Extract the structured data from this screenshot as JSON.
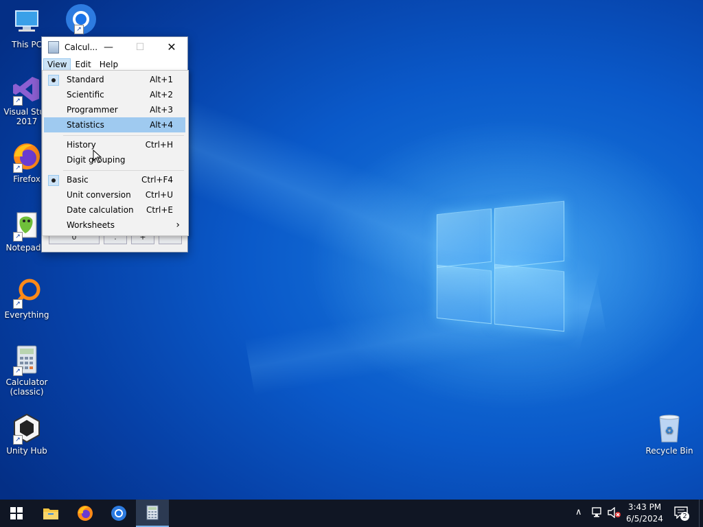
{
  "desktop": {
    "icons": [
      {
        "label": "This PC",
        "icon": "computer-icon"
      },
      {
        "label": "Visual Studio 2017",
        "icon": "visual-studio-icon"
      },
      {
        "label": "Firefox",
        "icon": "firefox-icon"
      },
      {
        "label": "Notepad++",
        "icon": "notepadpp-icon"
      },
      {
        "label": "Everything",
        "icon": "everything-search-icon"
      },
      {
        "label": "Calculator (classic)",
        "icon": "calculator-icon"
      },
      {
        "label": "Unity Hub",
        "icon": "unity-hub-icon"
      },
      {
        "label": "Recycle Bin",
        "icon": "recycle-bin-icon"
      }
    ],
    "icon_labels_visible": {
      "this_pc": "This PC",
      "visual_studio_line1": "Visual Stud",
      "visual_studio_line2": "2017",
      "firefox": "Firefox",
      "notepadpp": "Notepad+",
      "everything": "Everything",
      "calculator_line1": "Calculator",
      "calculator_line2": "(classic)",
      "unity": "Unity Hub",
      "recycle": "Recycle Bin"
    }
  },
  "calculator": {
    "title": "Calcul...",
    "minimize_glyph": "—",
    "maximize_glyph": "☐",
    "close_glyph": "✕",
    "menu": {
      "view": "View",
      "edit": "Edit",
      "help": "Help"
    },
    "partial_keys": [
      "0",
      ".",
      "+",
      ""
    ]
  },
  "view_menu": {
    "items": [
      {
        "label": "Standard",
        "shortcut": "Alt+1",
        "checked": true
      },
      {
        "label": "Scientific",
        "shortcut": "Alt+2",
        "checked": false
      },
      {
        "label": "Programmer",
        "shortcut": "Alt+3",
        "checked": false
      },
      {
        "label": "Statistics",
        "shortcut": "Alt+4",
        "checked": false,
        "highlighted": true
      },
      {
        "label": "History",
        "shortcut": "Ctrl+H",
        "checked": false
      },
      {
        "label": "Digit grouping",
        "shortcut": "",
        "checked": false
      },
      {
        "label": "Basic",
        "shortcut": "Ctrl+F4",
        "checked": true
      },
      {
        "label": "Unit conversion",
        "shortcut": "Ctrl+U",
        "checked": false
      },
      {
        "label": "Date calculation",
        "shortcut": "Ctrl+E",
        "checked": false
      },
      {
        "label": "Worksheets",
        "shortcut": "",
        "checked": false,
        "submenu": true
      }
    ],
    "submenu_glyph": "›"
  },
  "taskbar": {
    "items": [
      "start",
      "file-explorer",
      "firefox",
      "chrome",
      "calculator"
    ],
    "time": "3:43 PM",
    "date": "6/5/2024",
    "notification_count": "2",
    "tray_chevron": "∧"
  },
  "colors": {
    "highlight": "#9fcaf0",
    "taskbar": "#101624",
    "accent": "#0a59c9"
  }
}
